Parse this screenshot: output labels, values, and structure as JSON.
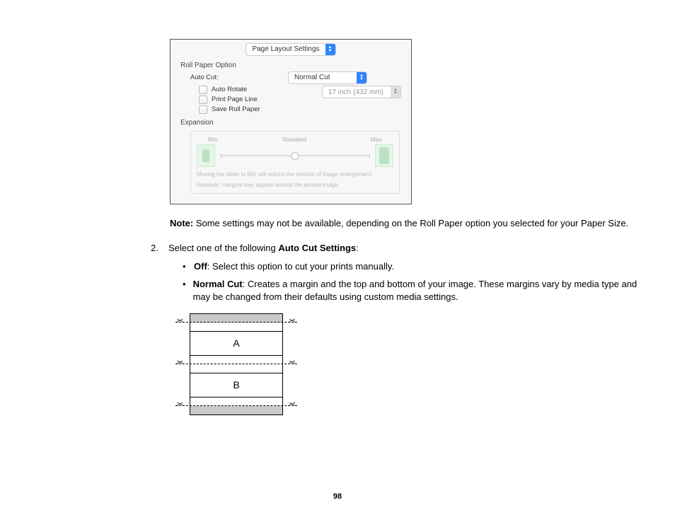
{
  "panel": {
    "topSelect": "Page Layout Settings",
    "section1": "Roll Paper Option",
    "autoCutLabel": "Auto Cut:",
    "autoCutValue": "Normal Cut",
    "widthValue": "17 inch (432 mm)",
    "chkAutoRotate": "Auto Rotate",
    "chkPrintPageLine": "Print Page Line",
    "chkSaveRollPaper": "Save Roll Paper",
    "section2": "Expansion",
    "slider": {
      "min": "Min",
      "std": "Standard",
      "max": "Max"
    },
    "hint1": "Moving the slider to Min will reduce the amount of image enlargement.",
    "hint2": "However, margins may appear around the printed image."
  },
  "note": {
    "prefix": "Note:",
    "body": " Some settings may not be available, depending on the Roll Paper option you selected for your Paper Size."
  },
  "step": {
    "num": "2.",
    "lead": "Select one of the following ",
    "strong": "Auto Cut Settings",
    "tail": ":"
  },
  "bullets": {
    "b1strong": "Off",
    "b1rest": ": Select this option to cut your prints manually.",
    "b2strong": "Normal Cut",
    "b2rest": ": Creates a margin and the top and bottom of your image. These margins vary by media type and may be changed from their defaults using custom media settings."
  },
  "diagram": {
    "a": "A",
    "b": "B"
  },
  "pageNumber": "98"
}
